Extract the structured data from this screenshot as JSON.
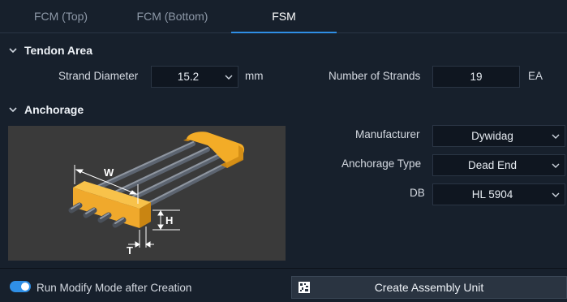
{
  "tabs": [
    {
      "label": "FCM (Top)"
    },
    {
      "label": "FCM (Bottom)"
    },
    {
      "label": "FSM"
    }
  ],
  "tendon": {
    "title": "Tendon Area",
    "strand_diameter_label": "Strand Diameter",
    "strand_diameter_value": "15.2",
    "strand_diameter_unit": "mm",
    "num_strands_label": "Number of Strands",
    "num_strands_value": "19",
    "num_strands_unit": "EA"
  },
  "anchorage": {
    "title": "Anchorage",
    "manufacturer_label": "Manufacturer",
    "manufacturer_value": "Dywidag",
    "type_label": "Anchorage Type",
    "type_value": "Dead End",
    "db_label": "DB",
    "db_value": "HL 5904",
    "image_labels": {
      "w": "W",
      "h": "H",
      "t": "T"
    }
  },
  "footer": {
    "toggle_label": "Run Modify Mode after Creation",
    "toggle_on": true,
    "create_button": "Create Assembly Unit"
  },
  "colors": {
    "accent": "#2f8fe6",
    "anchor": "#f0a92c"
  }
}
